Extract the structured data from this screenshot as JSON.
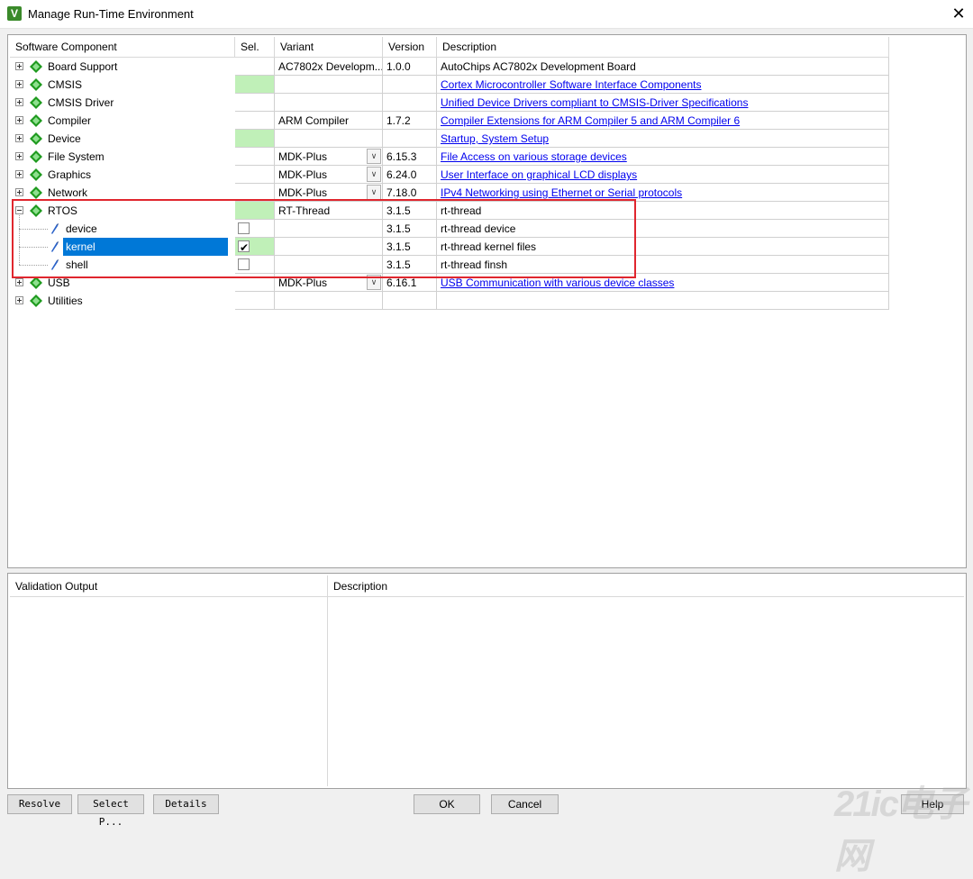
{
  "window": {
    "title": "Manage Run-Time Environment",
    "close_glyph": "✕"
  },
  "table": {
    "headers": [
      "Software Component",
      "Sel.",
      "Variant",
      "Version",
      "Description"
    ],
    "rows": [
      {
        "name": "Board Support",
        "variant": "AC7802x Developm...",
        "version": "1.0.0",
        "desc": "AutoChips AC7802x Development Board",
        "link": false
      },
      {
        "name": "CMSIS",
        "variant": "",
        "version": "",
        "desc": "Cortex Microcontroller Software Interface Components",
        "link": true,
        "green": true
      },
      {
        "name": "CMSIS Driver",
        "variant": "",
        "version": "",
        "desc": "Unified Device Drivers compliant to CMSIS-Driver Specifications",
        "link": true
      },
      {
        "name": "Compiler",
        "variant": "ARM Compiler",
        "version": "1.7.2",
        "desc": "Compiler Extensions for ARM Compiler 5 and ARM Compiler 6",
        "link": true
      },
      {
        "name": "Device",
        "variant": "",
        "version": "",
        "desc": "Startup, System Setup",
        "link": true,
        "green": true
      },
      {
        "name": "File System",
        "variant": "MDK-Plus",
        "version": "6.15.3",
        "desc": "File Access on various storage devices",
        "link": true,
        "dropdown": true
      },
      {
        "name": "Graphics",
        "variant": "MDK-Plus",
        "version": "6.24.0",
        "desc": "User Interface on graphical LCD displays",
        "link": true,
        "dropdown": true
      },
      {
        "name": "Network",
        "variant": "MDK-Plus",
        "version": "7.18.0",
        "desc": "IPv4 Networking using Ethernet or Serial protocols",
        "link": true,
        "dropdown": true
      },
      {
        "name": "RTOS",
        "variant": "RT-Thread",
        "version": "3.1.5",
        "desc": "rt-thread",
        "link": false,
        "green": true,
        "expanded": true
      },
      {
        "name": "device",
        "variant": "",
        "version": "3.1.5",
        "desc": "rt-thread device",
        "link": false,
        "child": true,
        "checkbox": true,
        "checked": false
      },
      {
        "name": "kernel",
        "variant": "",
        "version": "3.1.5",
        "desc": "rt-thread kernel files",
        "link": false,
        "child": true,
        "checkbox": true,
        "checked": true,
        "green": true,
        "selected": true
      },
      {
        "name": "shell",
        "variant": "",
        "version": "3.1.5",
        "desc": "rt-thread finsh",
        "link": false,
        "child": true,
        "checkbox": true,
        "checked": false
      },
      {
        "name": "USB",
        "variant": "MDK-Plus",
        "version": "6.16.1",
        "desc": "USB Communication with various device classes",
        "link": true,
        "dropdown": true
      },
      {
        "name": "Utilities",
        "variant": "",
        "version": "",
        "desc": "",
        "link": false
      }
    ]
  },
  "validation": {
    "output_header": "Validation Output",
    "description_header": "Description"
  },
  "buttons": {
    "resolve": "Resolve",
    "select": "Select P...",
    "details": "Details",
    "ok": "OK",
    "cancel": "Cancel",
    "help": "Help"
  },
  "watermark": "21ic电子网",
  "colors": {
    "selection": "#0078d7",
    "green_sel": "#c0f0b8",
    "link": "#0000ee",
    "highlight_box": "#e0262e"
  }
}
